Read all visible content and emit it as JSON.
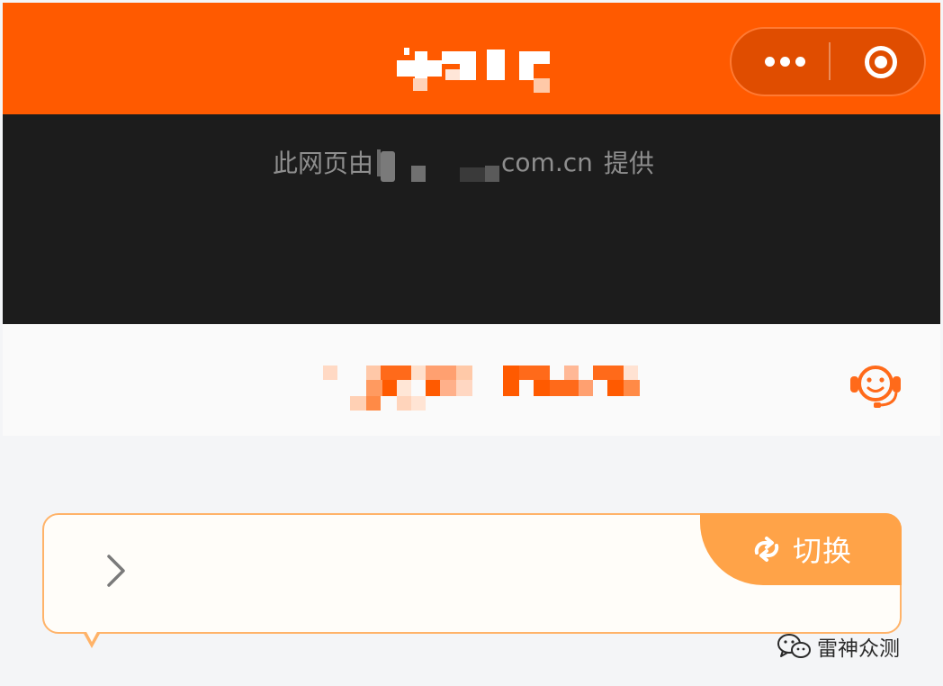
{
  "nav": {
    "title": "",
    "more_icon": "more-dots-icon",
    "close_icon": "target-circle-icon"
  },
  "provider_notice": {
    "prefix": "此网页由",
    "domain_suffix": "com.cn",
    "suffix": "提供"
  },
  "page_header": {
    "title": "",
    "service_icon": "customer-service-icon"
  },
  "notice_card": {
    "chevron_icon": "chevron-right-icon",
    "switch_label": "切换",
    "switch_icon": "refresh-swap-icon"
  },
  "watermark": {
    "text": "雷神众测",
    "icon": "wechat-icon"
  },
  "colors": {
    "brand_orange": "#ff5a00",
    "dark_band": "#1c1c1c",
    "accent_light_orange": "#ffa348",
    "card_border": "#ffb369"
  }
}
